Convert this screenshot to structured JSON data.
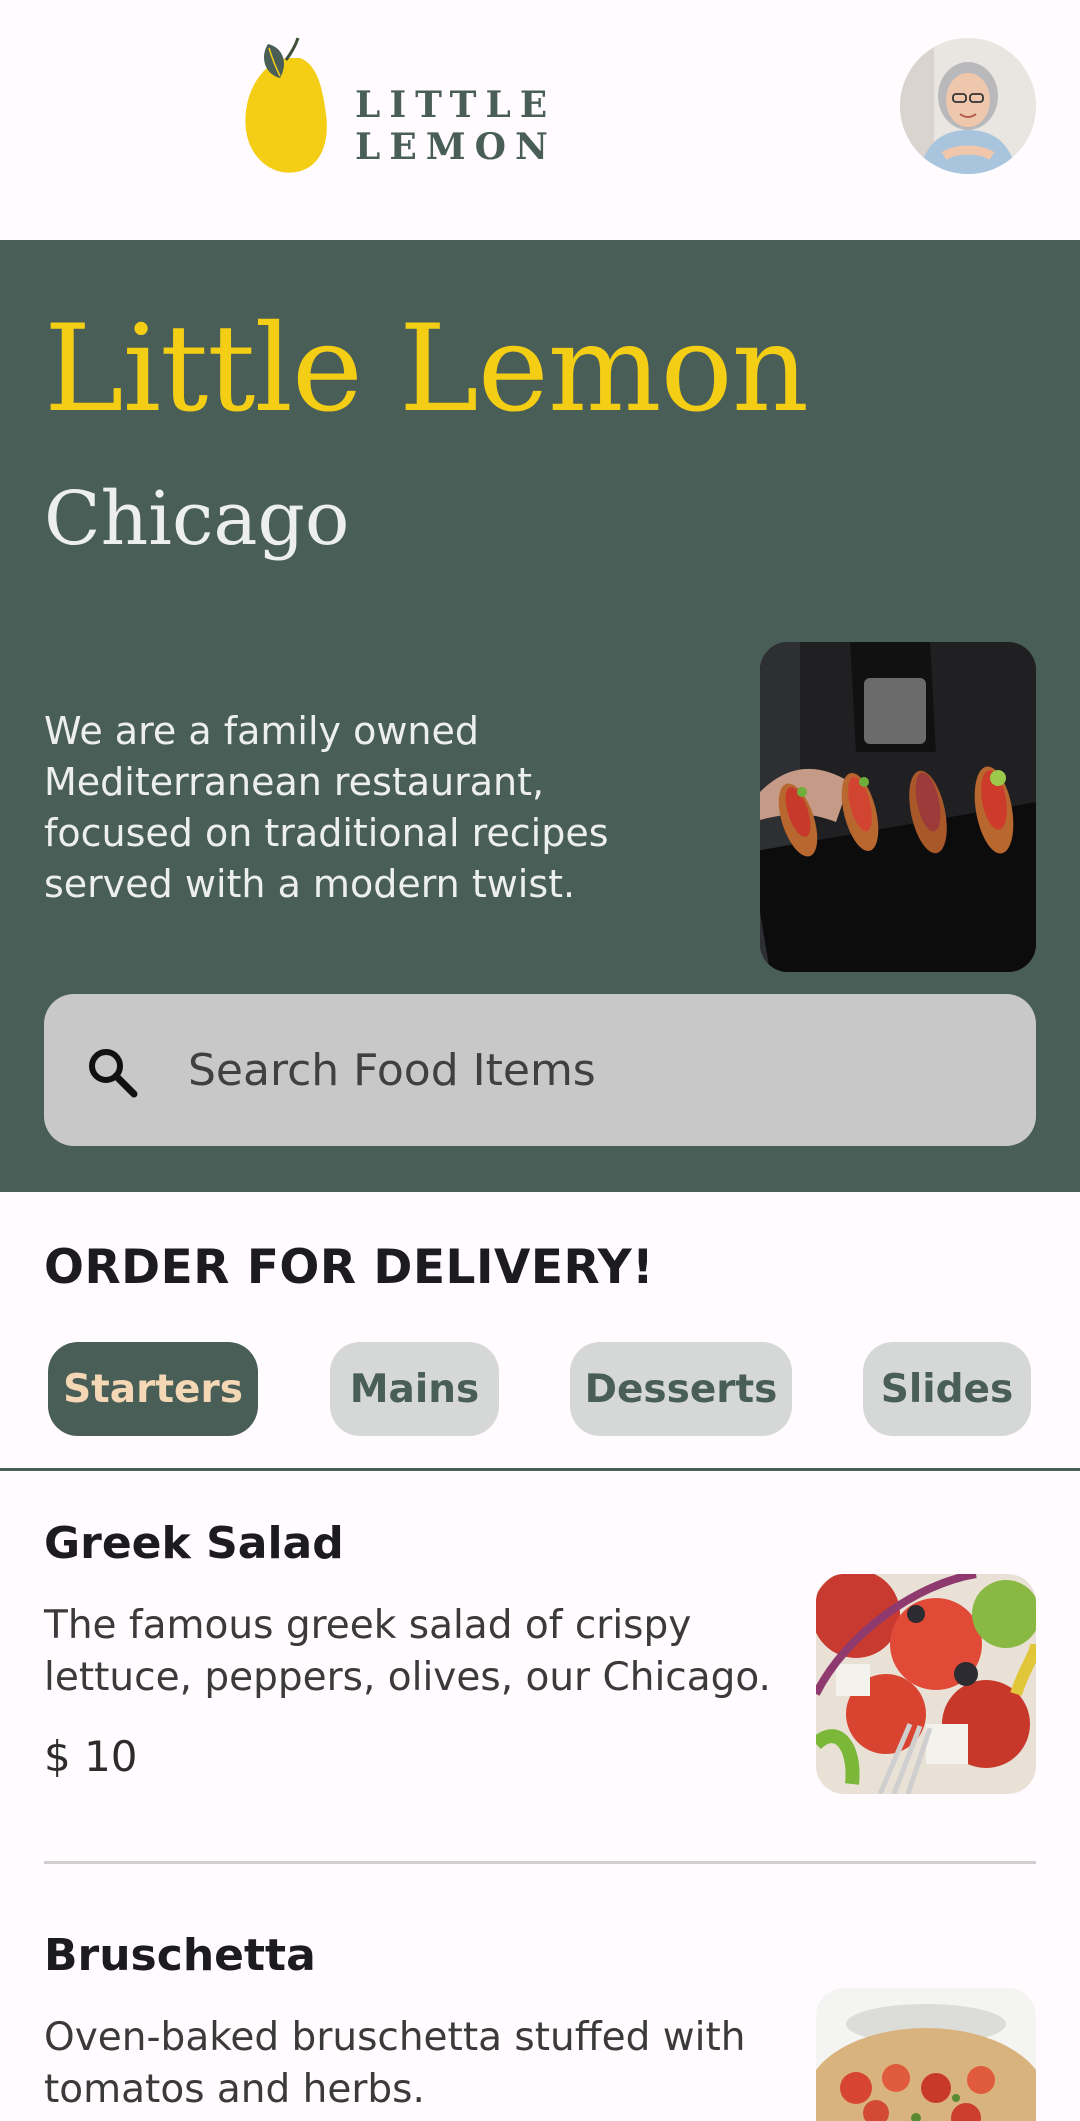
{
  "header": {
    "logo_text": "LITTLE LEMON",
    "logo_icon": "lemon-icon",
    "avatar_icon": "profile-avatar"
  },
  "hero": {
    "title": "Little Lemon",
    "city": "Chicago",
    "description": "We are a family owned Mediterranean restaurant, focused on traditional recipes served with a modern twist.",
    "image": "bruschetta-platter-photo"
  },
  "search": {
    "placeholder": "Search Food Items",
    "icon": "search-icon"
  },
  "order": {
    "title": "ORDER FOR DELIVERY!",
    "categories": [
      {
        "label": "Starters",
        "selected": true
      },
      {
        "label": "Mains",
        "selected": false
      },
      {
        "label": "Desserts",
        "selected": false
      },
      {
        "label": "Slides",
        "selected": false
      }
    ]
  },
  "menu": {
    "items": [
      {
        "title": "Greek Salad",
        "description": "The famous greek salad of crispy lettuce, peppers, olives, our Chicago.",
        "price": "$ 10",
        "image": "greek-salad-photo"
      },
      {
        "title": "Bruschetta",
        "description": "Oven-baked bruschetta stuffed with tomatos and herbs.",
        "image": "bruschetta-photo"
      }
    ]
  },
  "colors": {
    "primary_green": "#495E57",
    "primary_yellow": "#F4CE14",
    "background": "#FFFBFE",
    "chip_inactive": "#D6D8D7",
    "chip_active_text": "#F4D7B4",
    "search_background": "#C8C8C8"
  }
}
